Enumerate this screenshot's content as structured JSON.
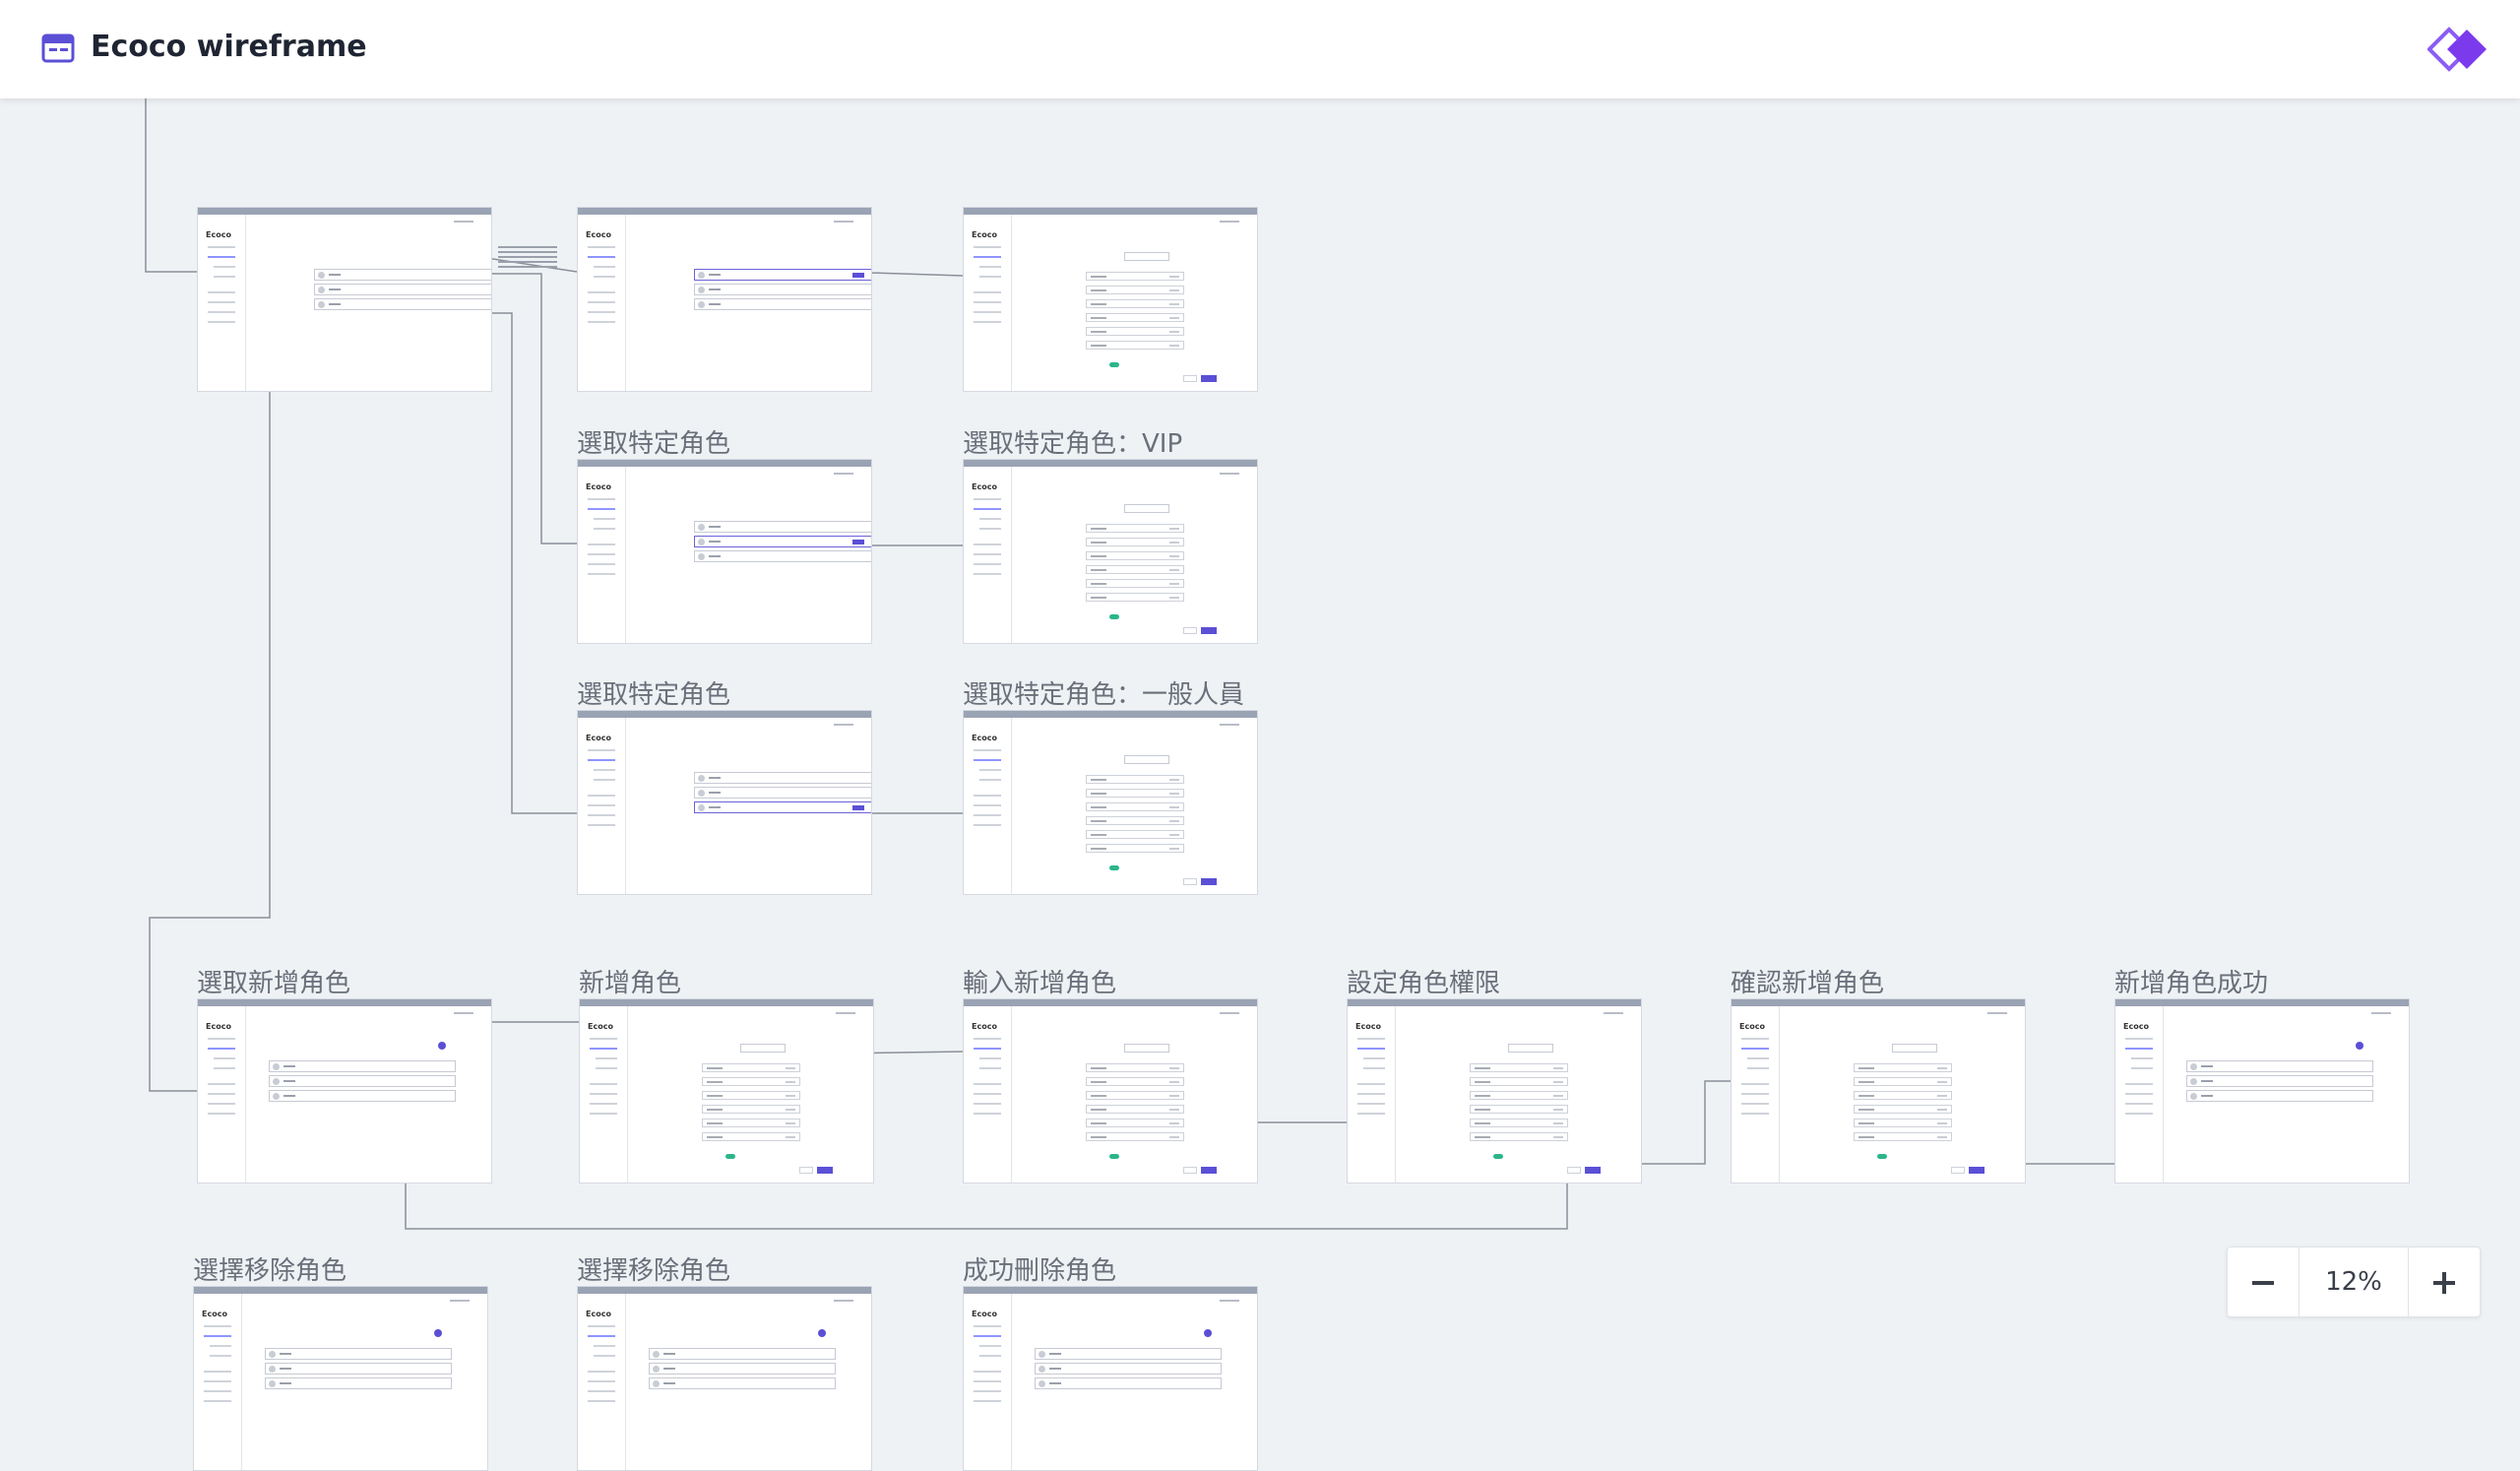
{
  "header": {
    "title": "Ecoco wireframe",
    "file_icon": "browser-window-icon",
    "logo": "zeplin-diamond-logo"
  },
  "colors": {
    "accent": "#5b4fd6",
    "canvas_bg": "#eff2f5",
    "connector": "#8a8f99",
    "toggle_on": "#2bb58b"
  },
  "frames": [
    {
      "id": "f1",
      "label": "",
      "kind": "list"
    },
    {
      "id": "f2",
      "label": "",
      "kind": "list-selected"
    },
    {
      "id": "f3",
      "label": "",
      "kind": "form"
    },
    {
      "id": "f4",
      "label": "選取特定角色",
      "kind": "list-selected"
    },
    {
      "id": "f5",
      "label": "選取特定角色：VIP",
      "kind": "form"
    },
    {
      "id": "f6",
      "label": "選取特定角色",
      "kind": "list-selected"
    },
    {
      "id": "f7",
      "label": "選取特定角色：一般人員",
      "kind": "form"
    },
    {
      "id": "f8",
      "label": "選取新增角色",
      "kind": "list-add"
    },
    {
      "id": "f9",
      "label": "新增角色",
      "kind": "form"
    },
    {
      "id": "f10",
      "label": "輸入新增角色",
      "kind": "form"
    },
    {
      "id": "f11",
      "label": "設定角色權限",
      "kind": "form"
    },
    {
      "id": "f12",
      "label": "確認新增角色",
      "kind": "form"
    },
    {
      "id": "f13",
      "label": "新增角色成功",
      "kind": "list-add"
    },
    {
      "id": "f14",
      "label": "選擇移除角色",
      "kind": "list-add"
    },
    {
      "id": "f15",
      "label": "選擇移除角色",
      "kind": "list-add"
    },
    {
      "id": "f16",
      "label": "成功刪除角色",
      "kind": "list-add"
    }
  ],
  "frame_brand": "Ecoco",
  "zoom": {
    "minus_icon": "minus-icon",
    "plus_icon": "plus-icon",
    "level": "12%"
  }
}
